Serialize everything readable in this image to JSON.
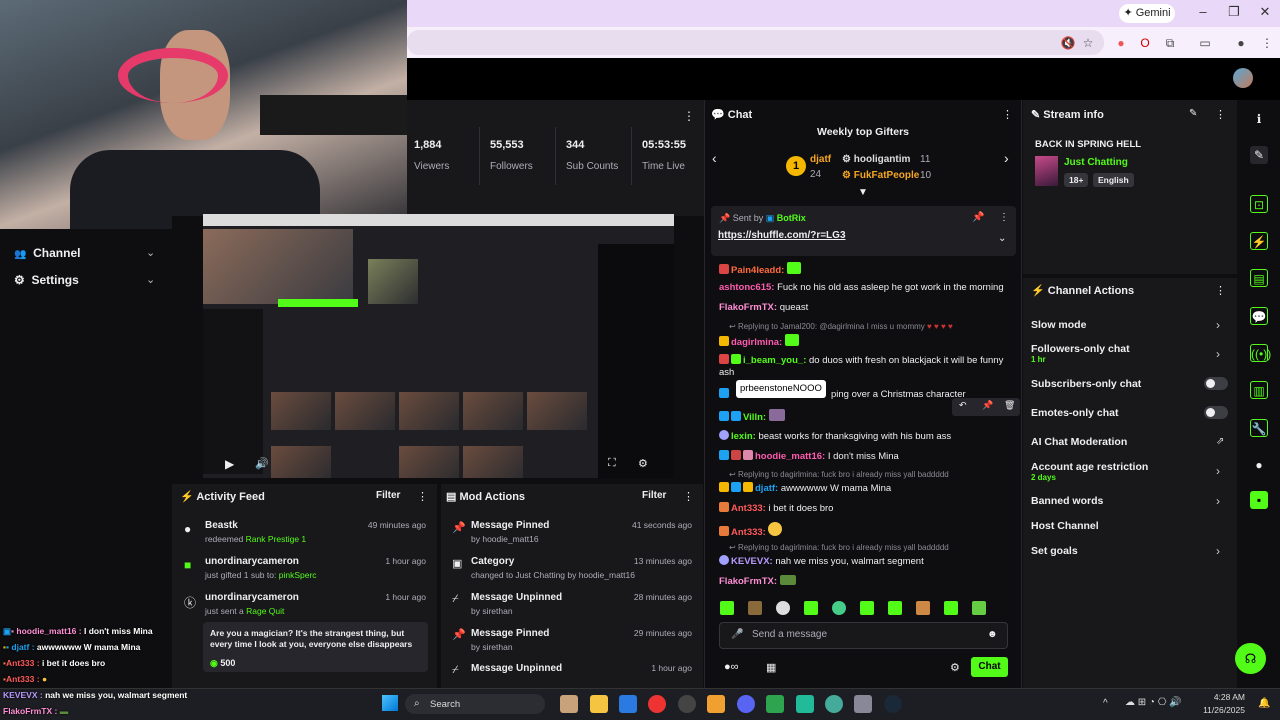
{
  "browser": {
    "gemini_label": "Gemini"
  },
  "nav": {
    "channel_label": "Channel",
    "settings_label": "Settings"
  },
  "stats": [
    {
      "value": "1,884",
      "label": "Viewers"
    },
    {
      "value": "55,553",
      "label": "Followers"
    },
    {
      "value": "344",
      "label": "Sub Counts"
    },
    {
      "value": "05:53:55",
      "label": "Time Live"
    }
  ],
  "activity": {
    "title": "Activity Feed",
    "filter_label": "Filter",
    "items": [
      {
        "name": "Beastk",
        "detail_pre": "redeemed",
        "detail_hl": "Rank Prestige 1",
        "time": "49 minutes ago"
      },
      {
        "name": "unordinarycameron",
        "detail_pre": "just gifted 1 sub to:",
        "detail_hl": "pinkSperc",
        "time": "1 hour ago"
      },
      {
        "name": "unordinarycameron",
        "detail_pre": "just sent a",
        "detail_hl": "Rage Quit",
        "time": "1 hour ago",
        "message": "Are you a magician? It's the strangest thing, but every time I look at you, everyone else disappears",
        "amount": "500"
      }
    ]
  },
  "mod": {
    "title": "Mod Actions",
    "filter_label": "Filter",
    "items": [
      {
        "action": "Message Pinned",
        "detail": "by hoodie_matt16",
        "time": "41 seconds ago"
      },
      {
        "action": "Category",
        "detail": "changed to Just Chatting by hoodie_matt16",
        "time": "13 minutes ago"
      },
      {
        "action": "Message Unpinned",
        "detail": "by sirethan",
        "time": "28 minutes ago"
      },
      {
        "action": "Message Pinned",
        "detail": "by sirethan",
        "time": "29 minutes ago"
      },
      {
        "action": "Message Unpinned",
        "detail": "",
        "time": "1 hour ago"
      }
    ]
  },
  "chat": {
    "title": "Chat",
    "gifters_title": "Weekly top Gifters",
    "gifters": [
      {
        "name": "djatf",
        "count": "24"
      },
      {
        "name": "hooligantim",
        "count": "11"
      },
      {
        "name": "FukFatPeople",
        "count": "10"
      }
    ],
    "pinned": {
      "sent_by": "Sent by",
      "author": "BotRix",
      "link": "https://shuffle.com/?r=LG3"
    },
    "tooltip": "prbeenstoneNOOO",
    "lines": [
      {
        "user": "Pain4leadd:",
        "text": ""
      },
      {
        "user": "ashtonc615:",
        "text": "Fuck no his old ass asleep he got work in the morning"
      },
      {
        "user": "FlakoFrmTX:",
        "text": "queast"
      },
      {
        "reply": "Replying to Jamal200: @dagirlmina I miss u mommy"
      },
      {
        "user": "dagirlmina:",
        "text": ""
      },
      {
        "user": "i_beam_you_:",
        "text": "do duos with fresh on blackjack it will be funny ash"
      },
      {
        "user": "",
        "text": "ping over a Christmas character"
      },
      {
        "user": "Villn:",
        "text": ""
      },
      {
        "user": "lexin:",
        "text": "beast works for thanksgiving with his bum ass"
      },
      {
        "user": "hoodie_matt16:",
        "text": "I don't miss Mina"
      },
      {
        "reply": "Replying to dagirlmina: fuck bro i already miss yall baddddd"
      },
      {
        "user": "djatf:",
        "text": "awwwwww W mama Mina"
      },
      {
        "user": "Ant333:",
        "text": "i bet it does bro"
      },
      {
        "user": "Ant333:",
        "text": ""
      },
      {
        "reply": "Replying to dagirlmina: fuck bro i already miss yall baddddd"
      },
      {
        "user": "KEVEVX:",
        "text": "nah we miss you, walmart segment"
      },
      {
        "user": "FlakoFrmTX:",
        "text": ""
      }
    ],
    "input_placeholder": "Send a message",
    "send_label": "Chat"
  },
  "streaminfo": {
    "title": "Stream info",
    "stream_title": "BACK IN SPRING HELL",
    "category": "Just Chatting",
    "tags": [
      "18+",
      "English"
    ]
  },
  "actions": {
    "title": "Channel Actions",
    "items": [
      {
        "label": "Slow mode",
        "sub": ""
      },
      {
        "label": "Followers-only chat",
        "sub": "1 hr"
      },
      {
        "label": "Subscribers-only chat",
        "sub": ""
      },
      {
        "label": "Emotes-only chat",
        "sub": ""
      },
      {
        "label": "AI Chat Moderation",
        "sub": ""
      },
      {
        "label": "Account age restriction",
        "sub": "2 days"
      },
      {
        "label": "Banned words",
        "sub": ""
      },
      {
        "label": "Host Channel",
        "sub": ""
      },
      {
        "label": "Set goals",
        "sub": ""
      }
    ]
  },
  "overlay_chat": [
    {
      "user": "hoodie_matt16 :",
      "text": "I don't miss Mina"
    },
    {
      "user": "djatf :",
      "text": "awwwwww W mama Mina"
    },
    {
      "user": "Ant333 :",
      "text": "i bet it does bro"
    },
    {
      "user": "Ant333 :",
      "text": ""
    },
    {
      "user": "KEVEVX :",
      "text": "nah we miss you, walmart segment"
    },
    {
      "user": "FlakoFrmTX :",
      "text": ""
    }
  ],
  "taskbar": {
    "search_label": "Search",
    "time": "4:28 AM",
    "date": "11/26/2025"
  },
  "colors": {
    "accent": "#53fc18",
    "panel": "#18181b",
    "background": "#0e0e10"
  }
}
